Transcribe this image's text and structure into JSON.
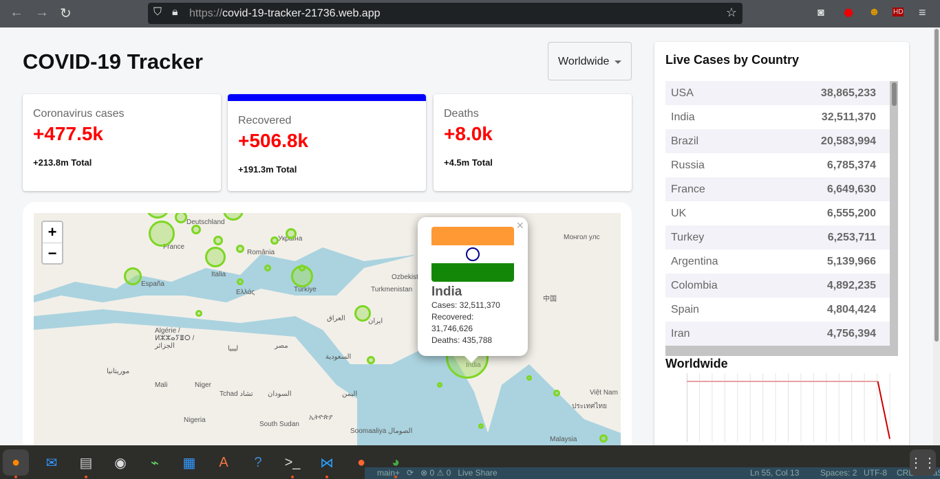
{
  "browser": {
    "url_scheme": "https://",
    "url_host": "covid-19-tracker-21736.web.app"
  },
  "header": {
    "title": "COVID-19 Tracker",
    "country_select": "Worldwide"
  },
  "cards": [
    {
      "title": "Coronavirus cases",
      "value": "+477.5k",
      "total": "+213.8m Total",
      "selected": false
    },
    {
      "title": "Recovered",
      "value": "+506.8k",
      "total": "+191.3m Total",
      "selected": true
    },
    {
      "title": "Deaths",
      "value": "+8.0k",
      "total": "+4.5m Total",
      "selected": false
    }
  ],
  "map": {
    "zoom_in": "+",
    "zoom_out": "−",
    "labels": [
      "Deutschland",
      "France",
      "España",
      "Italia",
      "România",
      "Україна",
      "Ελλάς",
      "Türkiye",
      "Algérie / ⵍⵣⵣⴰⵢⴻⵔ / الجزائر",
      "ليبيا",
      "مصر",
      "العراق",
      "ایران",
      "السعودية",
      "Turkmenistan",
      "Mali",
      "Niger",
      "Tchad تشاد",
      "السودان",
      "اليمن",
      "Nigeria",
      "South Sudan",
      "Soomaaliya الصومال",
      "India",
      "中国",
      "Монгол улс",
      "Việt Nam",
      "ประเทศไทย",
      "Malaysia",
      "موريتانيا",
      "ኢትዮጵያ",
      "Ozbekiston"
    ],
    "popup": {
      "country": "India",
      "cases": "Cases: 32,511,370",
      "recovered_label": "Recovered:",
      "recovered": "31,746,626",
      "deaths": "Deaths: 435,788",
      "close": "×",
      "flag_colors": [
        "#ff9933",
        "#ffffff",
        "#138808"
      ]
    }
  },
  "sidebar": {
    "title": "Live Cases by Country",
    "countries": [
      {
        "name": "USA",
        "cases": "38,865,233"
      },
      {
        "name": "India",
        "cases": "32,511,370"
      },
      {
        "name": "Brazil",
        "cases": "20,583,994"
      },
      {
        "name": "Russia",
        "cases": "6,785,374"
      },
      {
        "name": "France",
        "cases": "6,649,630"
      },
      {
        "name": "UK",
        "cases": "6,555,200"
      },
      {
        "name": "Turkey",
        "cases": "6,253,711"
      },
      {
        "name": "Argentina",
        "cases": "5,139,966"
      },
      {
        "name": "Colombia",
        "cases": "4,892,235"
      },
      {
        "name": "Spain",
        "cases": "4,804,424"
      },
      {
        "name": "Iran",
        "cases": "4,756,394"
      }
    ],
    "chart_title": "Worldwide"
  },
  "chart_data": {
    "type": "line",
    "title": "Worldwide",
    "series": [
      {
        "values": [
          1,
          1,
          1,
          1,
          1,
          1,
          1,
          1,
          1,
          1,
          1,
          1,
          1,
          1,
          1,
          1,
          1,
          0.05
        ]
      }
    ],
    "color": "#cc0000"
  },
  "statusbar": {
    "branch": "main+",
    "problems": "0",
    "warnings": "0",
    "live_share": "Live Share",
    "position": "Ln 55, Col 13",
    "spaces": "Spaces: 2",
    "encoding": "UTF-8",
    "eol": "CRLF",
    "lang": "JavaS"
  }
}
